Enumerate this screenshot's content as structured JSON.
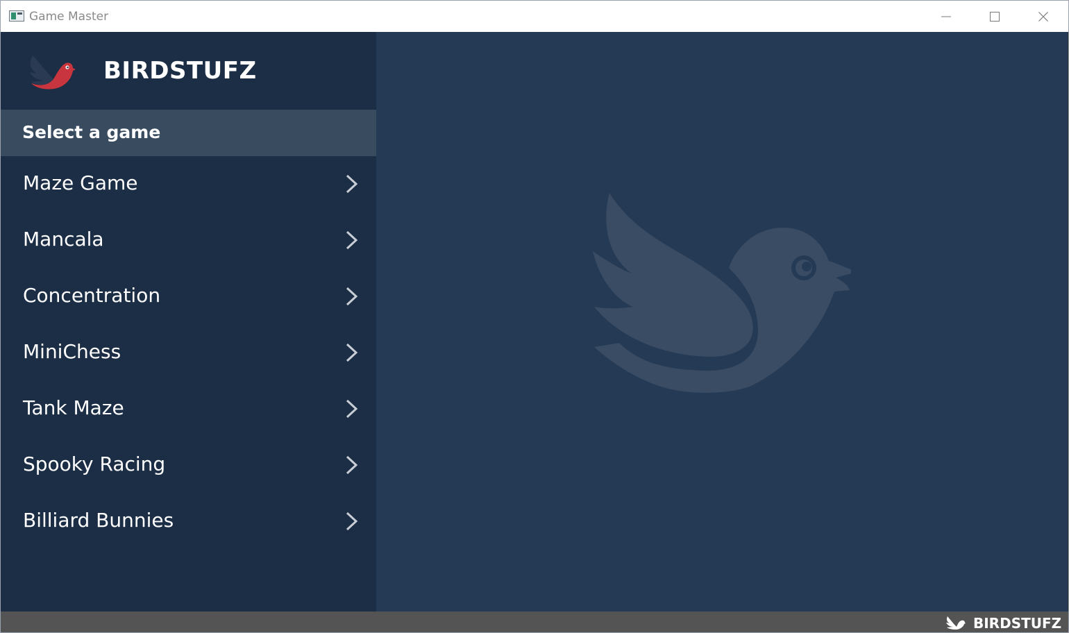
{
  "window": {
    "title": "Game Master"
  },
  "sidebar": {
    "brand_name": "BIRDSTUFZ",
    "section_title": "Select a game",
    "games": [
      {
        "label": "Maze Game"
      },
      {
        "label": "Mancala"
      },
      {
        "label": "Concentration"
      },
      {
        "label": "MiniChess"
      },
      {
        "label": "Tank Maze"
      },
      {
        "label": "Spooky Racing"
      },
      {
        "label": "Billiard Bunnies"
      }
    ]
  },
  "statusbar": {
    "brand_name": "BIRDSTUFZ"
  },
  "colors": {
    "sidebar_bg": "#1c2e45",
    "section_header_bg": "#394b5f",
    "main_bg": "#253a55",
    "watermark": "#3a4c63",
    "logo_accent": "#c9353f",
    "statusbar_bg": "#545454"
  },
  "icons": {
    "app": "app-window-icon",
    "brand": "bird-logo-icon",
    "item_arrow": "chevron-right-icon",
    "watermark": "bird-watermark-icon"
  }
}
